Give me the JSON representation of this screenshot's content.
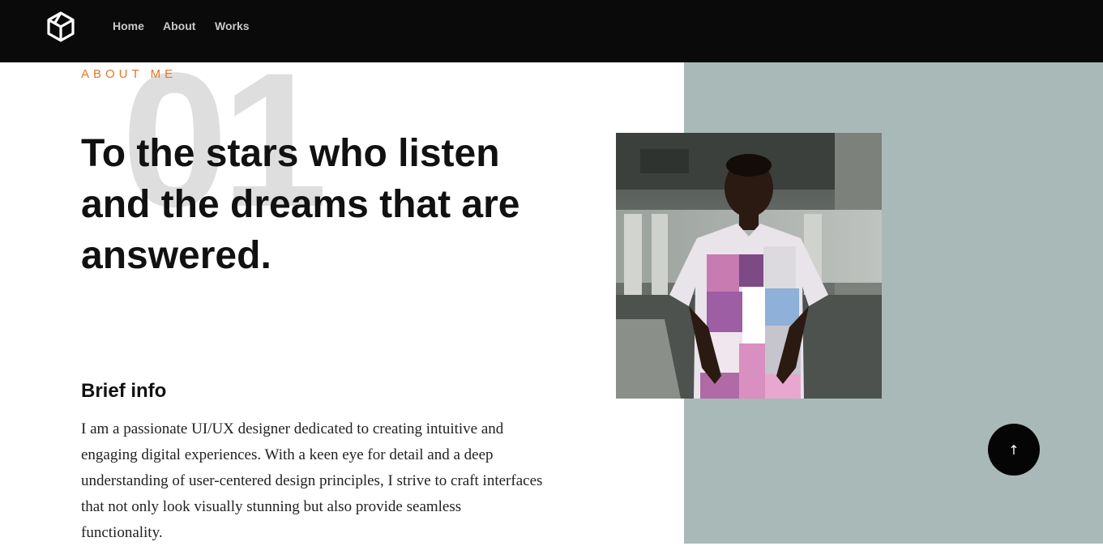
{
  "nav": {
    "logo_icon": "hexagon-cube-logo",
    "links": [
      {
        "label": "Home"
      },
      {
        "label": "About"
      },
      {
        "label": "Works"
      }
    ]
  },
  "hero": {
    "section_number": "01",
    "eyebrow": "ABOUT ME",
    "headline": "To the stars who listen and the dreams that are answered."
  },
  "brief": {
    "title": "Brief info",
    "text": "I am a passionate UI/UX designer dedicated to creating intuitive and engaging digital experiences. With a keen eye for detail and a deep understanding of user-centered design principles, I strive to craft interfaces that not only look visually stunning but also provide seamless functionality."
  },
  "scroll_top": {
    "icon": "arrow-up-icon",
    "glyph": "➚"
  },
  "colors": {
    "nav_bg": "#0a0a0a",
    "accent": "#e5762a",
    "panel_bg": "#a9b9b8",
    "big_number": "#dedede"
  }
}
